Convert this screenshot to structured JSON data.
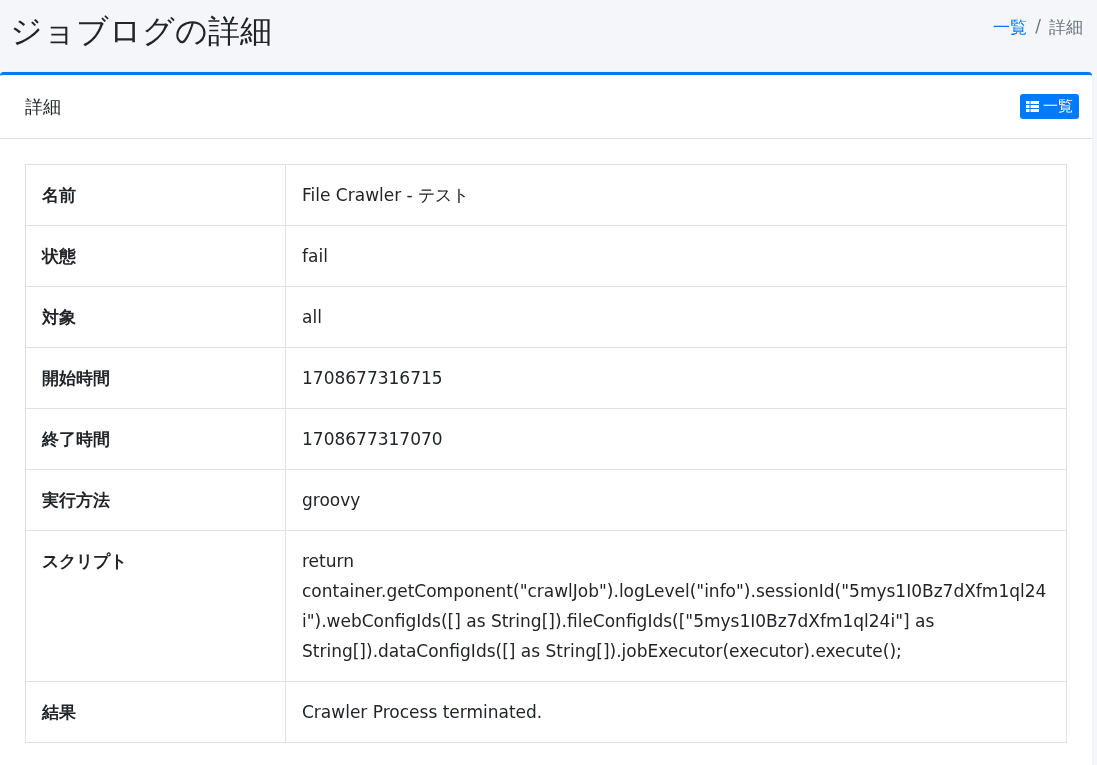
{
  "page_title": "ジョブログの詳細",
  "breadcrumb_separator": "/",
  "breadcrumb": [
    {
      "label": "一覧",
      "link": true
    },
    {
      "label": "詳細",
      "link": false
    }
  ],
  "card": {
    "title": "詳細",
    "list_button": "一覧"
  },
  "rows": [
    {
      "label": "名前",
      "value": "File Crawler - テスト"
    },
    {
      "label": "状態",
      "value": "fail"
    },
    {
      "label": "対象",
      "value": "all"
    },
    {
      "label": "開始時間",
      "value": "1708677316715"
    },
    {
      "label": "終了時間",
      "value": "1708677317070"
    },
    {
      "label": "実行方法",
      "value": "groovy"
    },
    {
      "label": "スクリプト",
      "value": "return container.getComponent(\"crawlJob\").logLevel(\"info\").sessionId(\"5mys1I0Bz7dXfm1ql24i\").webConfigIds([] as String[]).fileConfigIds([\"5mys1I0Bz7dXfm1ql24i\"] as String[]).dataConfigIds([] as String[]).jobExecutor(executor).execute();"
    },
    {
      "label": "結果",
      "value": "Crawler Process terminated."
    }
  ]
}
